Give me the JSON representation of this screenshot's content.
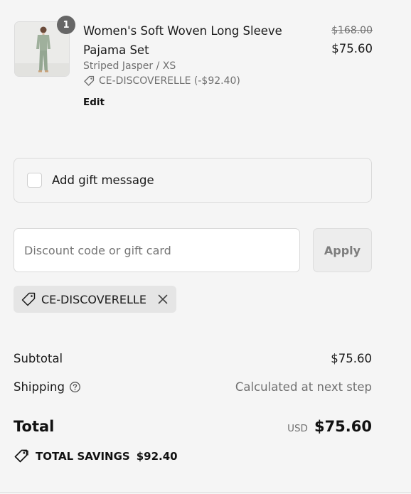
{
  "product": {
    "title": "Women's Soft Woven Long Sleeve Pajama Set",
    "variant": "Striped Jasper / XS",
    "quantity": "1",
    "discount_line": "CE-DISCOVERELLE (-$92.40)",
    "edit_label": "Edit",
    "original_price": "$168.00",
    "price": "$75.60",
    "image_icon": "pajama-set-photo"
  },
  "gift_message": {
    "label": "Add gift message",
    "checked": false
  },
  "discount": {
    "placeholder": "Discount code or gift card",
    "value": "",
    "apply_label": "Apply",
    "applied_code": "CE-DISCOVERELLE"
  },
  "summary": {
    "subtotal_label": "Subtotal",
    "subtotal_value": "$75.60",
    "shipping_label": "Shipping",
    "shipping_value": "Calculated at next step",
    "total_label": "Total",
    "currency": "USD",
    "total_value": "$75.60",
    "savings_label": "TOTAL SAVINGS",
    "savings_value": "$92.40"
  },
  "colors": {
    "background": "#f5f5f5",
    "text": "#1a1a1a",
    "muted": "#707070",
    "badge": "#666666",
    "product_garment": "#9fb09c"
  }
}
